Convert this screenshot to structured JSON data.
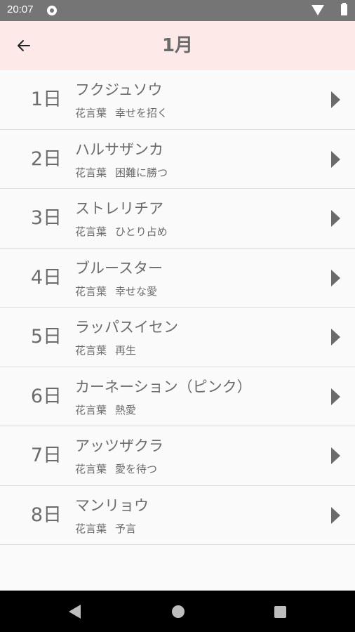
{
  "status_bar": {
    "time": "20:07",
    "app_icon": "app-notification-icon",
    "wifi_icon": "wifi-icon",
    "battery_icon": "battery-icon"
  },
  "app_bar": {
    "back_icon": "arrow-left-icon",
    "title": "1月",
    "background": "#fde9e7"
  },
  "list": {
    "meaning_label": "花言葉",
    "items": [
      {
        "day": "1日",
        "name": "フクジュソウ",
        "meaning": "幸せを招く"
      },
      {
        "day": "2日",
        "name": "ハルサザンカ",
        "meaning": "困難に勝つ"
      },
      {
        "day": "3日",
        "name": "ストレリチア",
        "meaning": "ひとり占め"
      },
      {
        "day": "4日",
        "name": "ブルースター",
        "meaning": "幸せな愛"
      },
      {
        "day": "5日",
        "name": "ラッパスイセン",
        "meaning": "再生"
      },
      {
        "day": "6日",
        "name": "カーネーション（ピンク）",
        "meaning": "熱愛"
      },
      {
        "day": "7日",
        "name": "アッツザクラ",
        "meaning": "愛を待つ"
      },
      {
        "day": "8日",
        "name": "マンリョウ",
        "meaning": "予言"
      }
    ]
  },
  "nav_bar": {
    "back_icon": "nav-back-icon",
    "home_icon": "nav-home-icon",
    "recents_icon": "nav-recents-icon"
  }
}
